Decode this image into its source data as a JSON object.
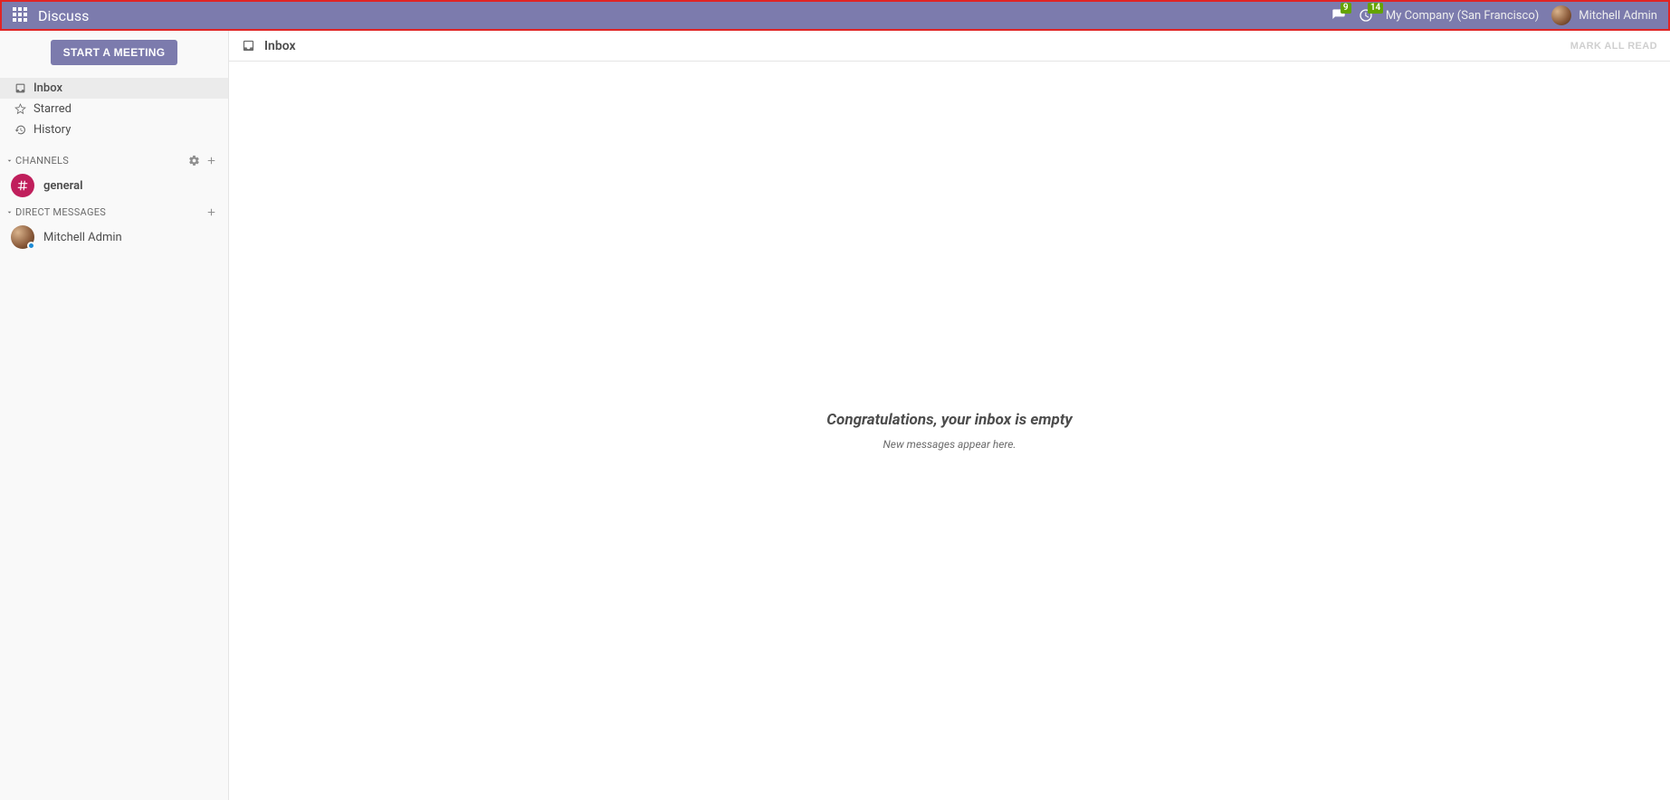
{
  "navbar": {
    "brand": "Discuss",
    "messages_badge": "9",
    "activities_badge": "14",
    "company": "My Company (San Francisco)",
    "user": "Mitchell Admin"
  },
  "sidebar": {
    "start_meeting": "START A MEETING",
    "mailboxes": [
      {
        "label": "Inbox",
        "icon": "inbox",
        "active": true
      },
      {
        "label": "Starred",
        "icon": "star",
        "active": false
      },
      {
        "label": "History",
        "icon": "history",
        "active": false
      }
    ],
    "channels_header": "CHANNELS",
    "channels": [
      {
        "name": "general"
      }
    ],
    "dm_header": "DIRECT MESSAGES",
    "dms": [
      {
        "name": "Mitchell Admin"
      }
    ]
  },
  "thread": {
    "title": "Inbox",
    "mark_all_read": "MARK ALL READ",
    "empty_title": "Congratulations, your inbox is empty",
    "empty_sub": "New messages appear here."
  }
}
